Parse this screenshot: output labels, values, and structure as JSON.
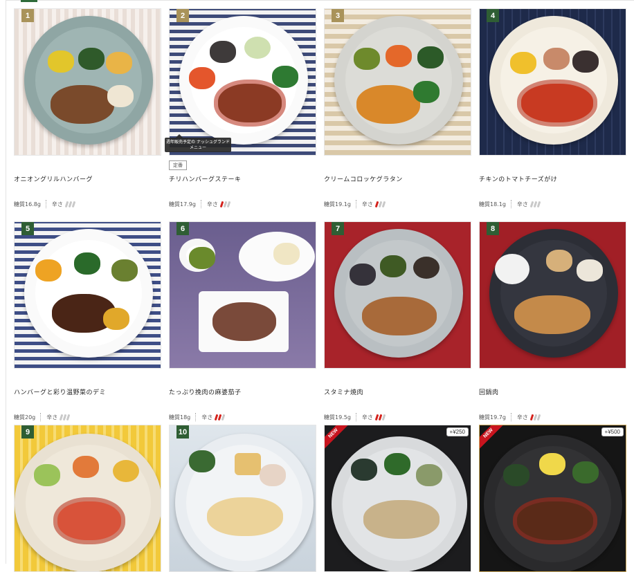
{
  "labels": {
    "carb_prefix": "糖質",
    "spice_label": "辛さ"
  },
  "colors": {
    "accent": "#2f5e34",
    "chili_on": "#d4221c",
    "chili_off": "#c9c9c9",
    "new": "#c8141e"
  },
  "items": [
    {
      "num": "1",
      "name": "オニオングリルハンバーグ",
      "carb": "16.8g",
      "spice": 0
    },
    {
      "num": "2",
      "name": "チリハンバーグステーキ",
      "carb": "17.9g",
      "spice": 1,
      "tag": "定番",
      "tooltip": "週年販売予定の ナッシュグランドメニュー"
    },
    {
      "num": "3",
      "name": "クリームコロッケグラタン",
      "carb": "19.1g",
      "spice": 1
    },
    {
      "num": "4",
      "name": "チキンのトマトチーズがけ",
      "carb": "18.1g",
      "spice": 0
    },
    {
      "num": "5",
      "name": "ハンバーグと彩り温野菜のデミ",
      "carb": "20g",
      "spice": 0
    },
    {
      "num": "6",
      "name": "たっぷり挽肉の麻婆茄子",
      "carb": "18g",
      "spice": 2
    },
    {
      "num": "7",
      "name": "スタミナ焼肉",
      "carb": "19.5g",
      "spice": 2
    },
    {
      "num": "8",
      "name": "回鍋肉",
      "carb": "19.7g",
      "spice": 1
    },
    {
      "num": "9"
    },
    {
      "num": "10"
    },
    {
      "new": "NEW",
      "price": "+¥250"
    },
    {
      "new": "NEW",
      "price": "+¥500"
    }
  ]
}
